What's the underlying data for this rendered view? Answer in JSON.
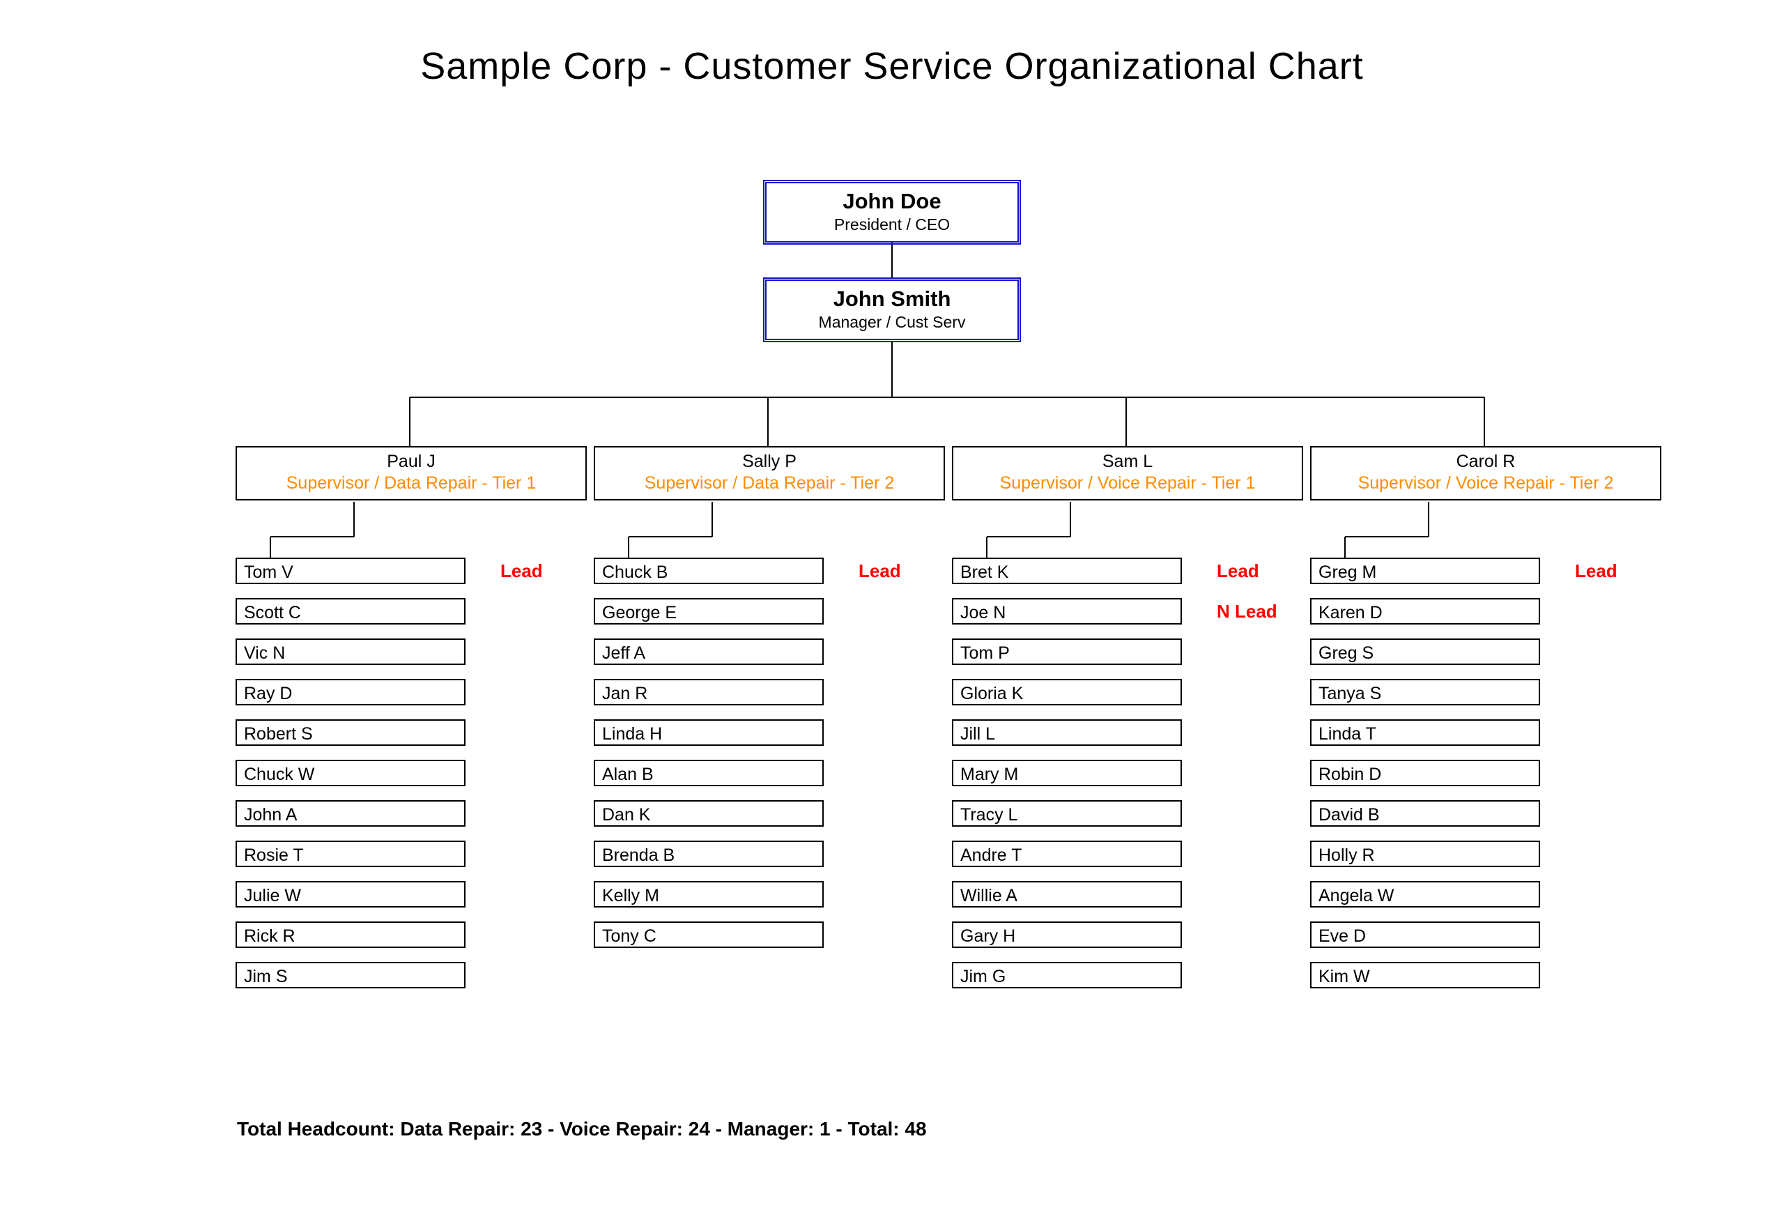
{
  "title": "Sample Corp - Customer Service Organizational Chart",
  "top": {
    "ceo": {
      "name": "John Doe",
      "role": "President / CEO"
    },
    "manager": {
      "name": "John Smith",
      "role": "Manager / Cust Serv"
    }
  },
  "supervisors": [
    {
      "name": "Paul J",
      "role": "Supervisor / Data Repair - Tier 1"
    },
    {
      "name": "Sally P",
      "role": "Supervisor / Data Repair - Tier 2"
    },
    {
      "name": "Sam L",
      "role": "Supervisor / Voice Repair - Tier 1"
    },
    {
      "name": "Carol R",
      "role": "Supervisor / Voice Repair - Tier 2"
    }
  ],
  "columns": [
    [
      {
        "name": "Tom V",
        "tag": "Lead"
      },
      {
        "name": "Scott C"
      },
      {
        "name": "Vic N"
      },
      {
        "name": "Ray D"
      },
      {
        "name": "Robert S"
      },
      {
        "name": "Chuck W"
      },
      {
        "name": "John A"
      },
      {
        "name": "Rosie T"
      },
      {
        "name": "Julie W"
      },
      {
        "name": "Rick R"
      },
      {
        "name": "Jim S"
      }
    ],
    [
      {
        "name": "Chuck B",
        "tag": "Lead"
      },
      {
        "name": "George E"
      },
      {
        "name": "Jeff A"
      },
      {
        "name": "Jan R"
      },
      {
        "name": "Linda H"
      },
      {
        "name": "Alan B"
      },
      {
        "name": "Dan K"
      },
      {
        "name": "Brenda B"
      },
      {
        "name": "Kelly M"
      },
      {
        "name": "Tony C"
      }
    ],
    [
      {
        "name": "Bret K",
        "tag": "Lead"
      },
      {
        "name": "Joe N",
        "tag": "N Lead"
      },
      {
        "name": "Tom P"
      },
      {
        "name": "Gloria K"
      },
      {
        "name": "Jill L"
      },
      {
        "name": "Mary M"
      },
      {
        "name": "Tracy L"
      },
      {
        "name": "Andre T"
      },
      {
        "name": "Willie A"
      },
      {
        "name": "Gary H"
      },
      {
        "name": "Jim G"
      }
    ],
    [
      {
        "name": "Greg M",
        "tag": "Lead"
      },
      {
        "name": "Karen D"
      },
      {
        "name": "Greg S"
      },
      {
        "name": "Tanya S"
      },
      {
        "name": "Linda T"
      },
      {
        "name": "Robin D"
      },
      {
        "name": "David B"
      },
      {
        "name": "Holly R"
      },
      {
        "name": "Angela W"
      },
      {
        "name": "Eve D"
      },
      {
        "name": "Kim W"
      }
    ]
  ],
  "footer": "Total Headcount:  Data Repair: 23  -  Voice Repair: 24  -  Manager: 1  -   Total: 48"
}
